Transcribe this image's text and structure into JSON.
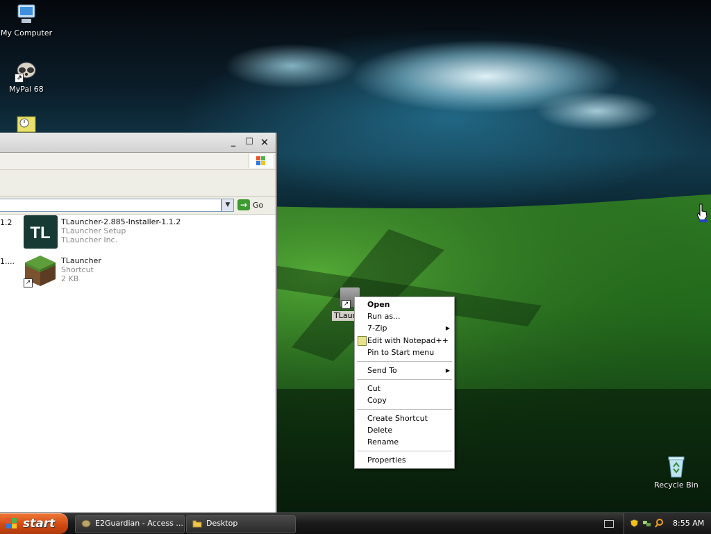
{
  "desktop": {
    "icons": [
      {
        "label": "My Computer"
      },
      {
        "label": "MyPal 68"
      },
      {
        "label": "Recycle Bin"
      }
    ],
    "tlauncher_shortcut_label": "TLaun"
  },
  "explorer": {
    "address_value": "",
    "go_label": "Go",
    "files": [
      {
        "name_prefix": "1.2",
        "name": "TLauncher-2.885-Installer-1.1.2",
        "line2": "TLauncher Setup",
        "line3": "TLauncher Inc.",
        "icon": "tlauncher-logo-icon"
      },
      {
        "name_prefix": "1....",
        "name": "TLauncher",
        "line2": "Shortcut",
        "line3": "2 KB",
        "icon": "minecraft-grass-block-icon"
      }
    ],
    "tl_logo_text": "TL"
  },
  "context_menu": {
    "items": [
      {
        "label": "Open",
        "bold": true
      },
      {
        "label": "Run as..."
      },
      {
        "label": "7-Zip",
        "submenu": true
      },
      {
        "label": "Edit with Notepad++",
        "icon": "notepad-plus-plus-icon"
      },
      {
        "label": "Pin to Start menu"
      },
      {
        "label": "Send To",
        "submenu": true
      },
      {
        "label": "Cut"
      },
      {
        "label": "Copy"
      },
      {
        "label": "Create Shortcut"
      },
      {
        "label": "Delete"
      },
      {
        "label": "Rename"
      },
      {
        "label": "Properties"
      }
    ]
  },
  "taskbar": {
    "start_label": "start",
    "tasks": [
      {
        "label": "E2Guardian - Access ...",
        "icon": "browser-icon"
      },
      {
        "label": "Desktop",
        "icon": "folder-icon"
      }
    ],
    "clock": "8:55 AM"
  },
  "colors": {
    "start_orange": "#d24a12",
    "tl_logo_bg": "#173b34"
  }
}
